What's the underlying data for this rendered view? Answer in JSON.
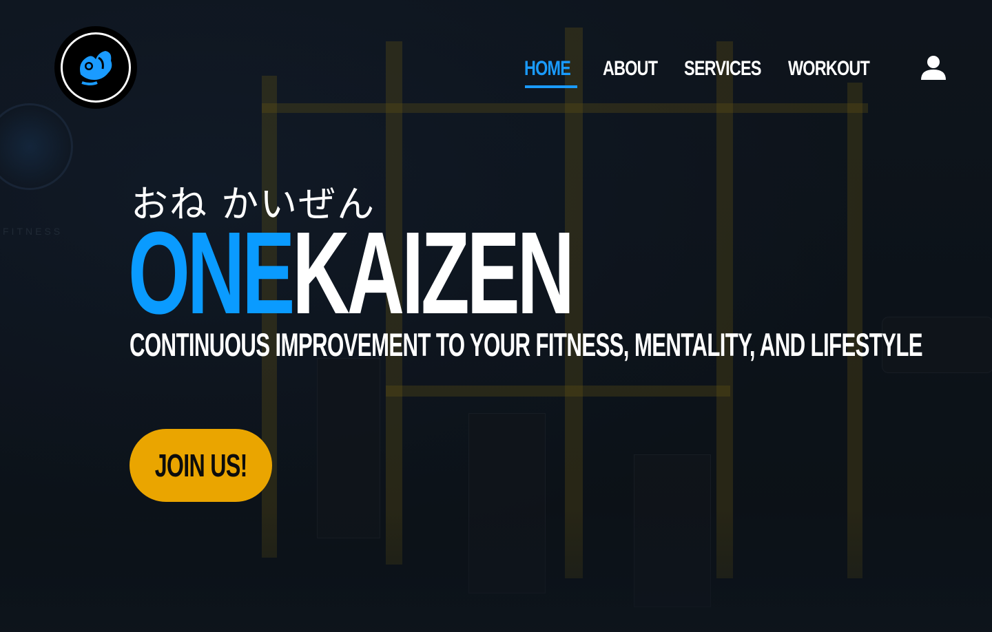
{
  "header": {
    "logo_alt": "OneKaizen logo",
    "nav": [
      {
        "label": "HOME",
        "active": true
      },
      {
        "label": "ABOUT",
        "active": false
      },
      {
        "label": "SERVICES",
        "active": false
      },
      {
        "label": "WORKOUT",
        "active": false
      }
    ],
    "user_icon": "user-icon"
  },
  "hero": {
    "japanese_text": "おね かいぜん",
    "brand_part1": "ONE",
    "brand_part2": "KAIZEN",
    "tagline": "CONTINUOUS IMPROVEMENT TO YOUR FITNESS, MENTALITY, AND LIFESTYLE",
    "cta_label": "JOIN US!"
  },
  "colors": {
    "accent_blue": "#0a9bff",
    "cta_yellow": "#eaa500",
    "text": "#ffffff",
    "background": "#0f141a"
  },
  "background": {
    "wall_text": "FITNESS"
  }
}
